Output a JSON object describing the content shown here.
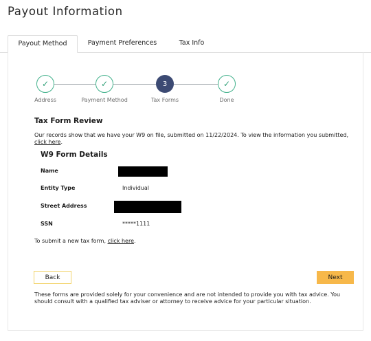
{
  "page": {
    "title": "Payout Information"
  },
  "tabs": [
    {
      "label": "Payout Method"
    },
    {
      "label": "Payment Preferences"
    },
    {
      "label": "Tax Info"
    }
  ],
  "steps": [
    {
      "label": "Address",
      "state": "done",
      "mark": "✓"
    },
    {
      "label": "Payment Method",
      "state": "done",
      "mark": "✓"
    },
    {
      "label": "Tax Forms",
      "state": "current",
      "mark": "3"
    },
    {
      "label": "Done",
      "state": "done",
      "mark": "✓"
    }
  ],
  "review": {
    "heading": "Tax Form Review",
    "text": "Our records show that we have your W9 on file, submitted on 11/22/2024. To view the information you submitted, ",
    "link": "click here",
    "after": "."
  },
  "w9": {
    "heading": "W9 Form Details",
    "name_label": "Name",
    "entity_label": "Entity Type",
    "entity_value": "Individual",
    "street_label": "Street Address",
    "ssn_label": "SSN",
    "ssn_value": "*****1111"
  },
  "new_form": {
    "text": "To submit a new tax form, ",
    "link": "click here",
    "after": "."
  },
  "buttons": {
    "back": "Back",
    "next": "Next"
  },
  "disclaimer": "These forms are provided solely for your convenience and are not intended to provide you with tax advice. You should consult with a qualified tax adviser or attorney to receive advice for your particular situation.",
  "colors": {
    "accent": "#3c4a73",
    "done": "#3fb08a",
    "next_button": "#f7b84a",
    "back_border": "#f2d36a"
  }
}
